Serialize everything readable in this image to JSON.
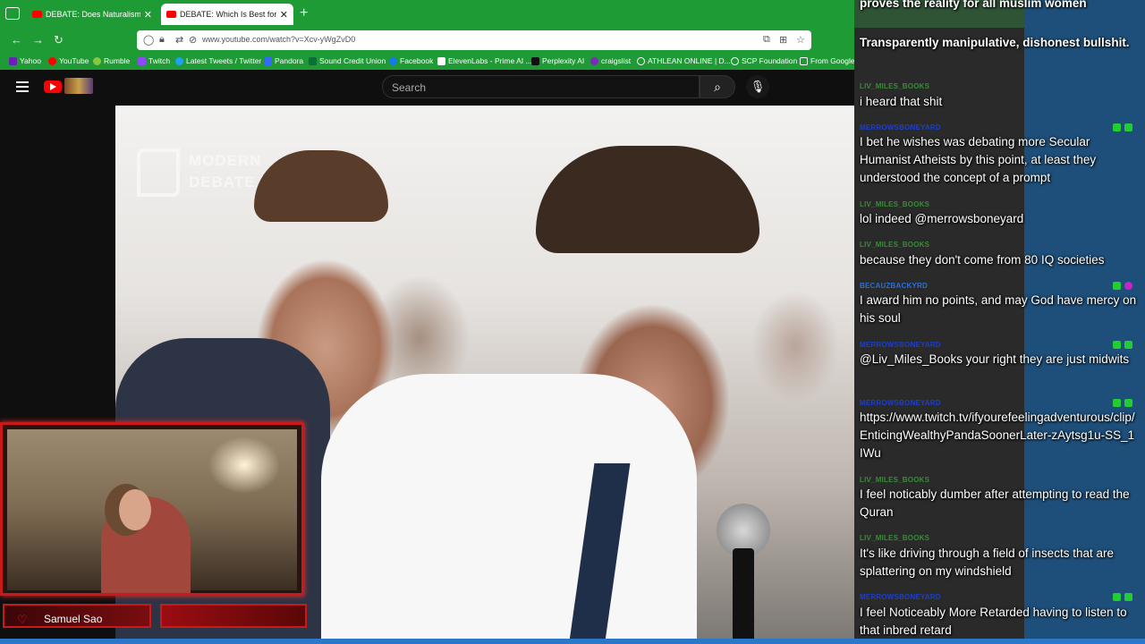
{
  "browser": {
    "tabs": [
      {
        "title": "DEBATE: Does Naturalism Expla",
        "active": false
      },
      {
        "title": "DEBATE: Which Is Best for Socie",
        "active": true
      }
    ],
    "url": "www.youtube.com/watch?v=Xcv-yWgZvD0",
    "bookmarks": [
      "Yahoo",
      "YouTube",
      "Rumble",
      "Twitch",
      "Latest Tweets / Twitter",
      "Pandora",
      "Sound Credit Union",
      "Facebook",
      "ElevenLabs - Prime AI ...",
      "Perplexity AI",
      "craigslist",
      "ATHLEAN ONLINE | D...",
      "SCP Foundation",
      "From Google"
    ]
  },
  "youtube": {
    "search_placeholder": "Search"
  },
  "video": {
    "watermark_line1": "MODERN",
    "watermark_line2": "DEBATE"
  },
  "webcam": {
    "name": "Samuel Sao"
  },
  "chat": {
    "messages": [
      {
        "user": "",
        "text": "proves the reality for all muslim women",
        "color": "#ffffff"
      },
      {
        "user": "",
        "text": "Transparently manipulative, dishonest bullshit.",
        "color": "#ffffff"
      },
      {
        "user": "LIV_MILES_BOOKS",
        "text": "i heard that shit",
        "color": "#3a8a3a"
      },
      {
        "user": "MERROWSBONEYARD",
        "text": "I bet he wishes was debating more Secular Humanist Atheists by this point, at least they understood the concept of a prompt",
        "color": "#1f3fbf"
      },
      {
        "user": "LIV_MILES_BOOKS",
        "text": "lol indeed @merrowsboneyard",
        "color": "#3a8a3a"
      },
      {
        "user": "LIV_MILES_BOOKS",
        "text": "because they don't come from 80 IQ societies",
        "color": "#3a8a3a"
      },
      {
        "user": "BECAUZBACKYRD",
        "text": "I award him no points, and may God have mercy on his soul",
        "color": "#2a6fd6"
      },
      {
        "user": "MERROWSBONEYARD",
        "text": "@Liv_Miles_Books your right they are just midwits",
        "color": "#1f3fbf"
      },
      {
        "user": "MERROWSBONEYARD",
        "text": "https://www.twitch.tv/ifyourefeelingadventurous/clip/EnticingWealthyPandaSoonerLater-zAytsg1u-SS_1IWu",
        "color": "#1f3fbf"
      },
      {
        "user": "LIV_MILES_BOOKS",
        "text": "I feel noticably dumber after attempting to read the Quran",
        "color": "#3a8a3a"
      },
      {
        "user": "LIV_MILES_BOOKS",
        "text": "It's like driving through a field of insects that are splattering on my windshield",
        "color": "#3a8a3a"
      },
      {
        "user": "MERROWSBONEYARD",
        "text": "I feel Noticeably More Retarded having to listen to that inbred retard",
        "color": "#1f3fbf"
      }
    ]
  },
  "colors": {
    "browser_accent": "#1f9b35",
    "webcam_frame": "#c8191b",
    "chat_overlay": "#1e4f7a"
  },
  "icons": [
    "menu-icon",
    "youtube-icon",
    "close-icon",
    "plus-icon",
    "back-icon",
    "forward-icon",
    "reload-icon",
    "shield-icon",
    "lock-icon",
    "search-icon",
    "mic-icon",
    "heart-icon"
  ]
}
